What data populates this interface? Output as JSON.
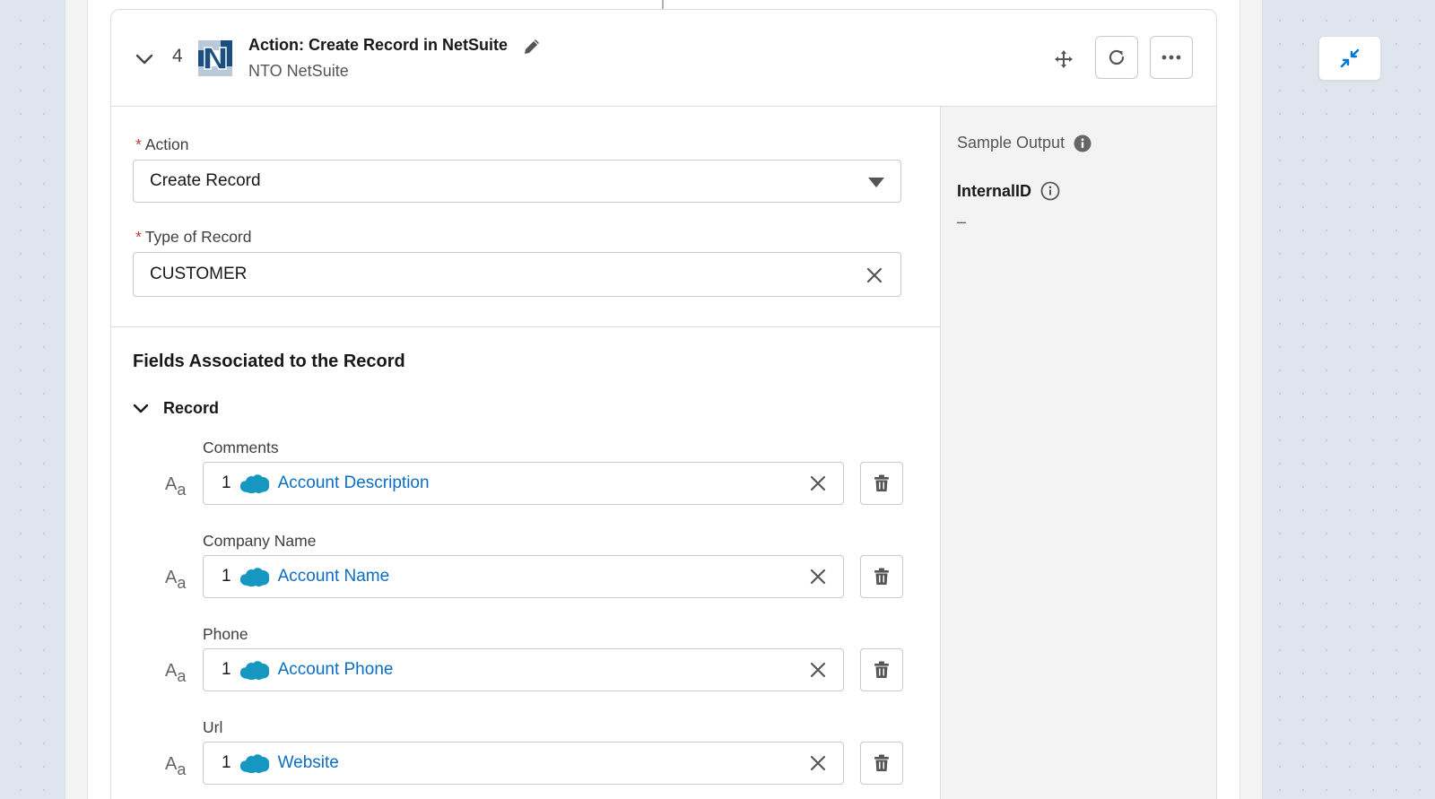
{
  "step": {
    "number": "4",
    "title": "Action: Create Record in NetSuite",
    "connection": "NTO NetSuite"
  },
  "form": {
    "action_label": "Action",
    "action_value": "Create Record",
    "record_type_label": "Type of Record",
    "record_type_value": "CUSTOMER",
    "required_marker": "*"
  },
  "fields_section": {
    "title": "Fields Associated to the Record",
    "group_label": "Record",
    "mappings": [
      {
        "label": "Comments",
        "step": "1",
        "value": "Account Description"
      },
      {
        "label": "Company Name",
        "step": "1",
        "value": "Account Name"
      },
      {
        "label": "Phone",
        "step": "1",
        "value": "Account Phone"
      },
      {
        "label": "Url",
        "step": "1",
        "value": "Website"
      }
    ],
    "type_icon_text": "A",
    "type_icon_sub": "a"
  },
  "sample_output": {
    "title": "Sample Output",
    "field_name": "InternalID",
    "field_value": "–"
  },
  "icons": {
    "expand": "chevron-down-icon",
    "logo": "netsuite-logo-icon",
    "edit": "pencil-icon",
    "move": "move-icon",
    "refresh": "refresh-icon",
    "more": "ellipsis-icon",
    "info": "info-icon",
    "dropdown": "caret-down-icon",
    "clear": "close-icon",
    "delete": "trash-icon",
    "source": "salesforce-cloud-icon",
    "collapse": "contract-icon"
  },
  "colors": {
    "link": "#0b6dc4",
    "required": "#c23934",
    "salesforce": "#1798c1",
    "netsuite_dark": "#1c4e80",
    "collapse_icon": "#0176d3"
  }
}
